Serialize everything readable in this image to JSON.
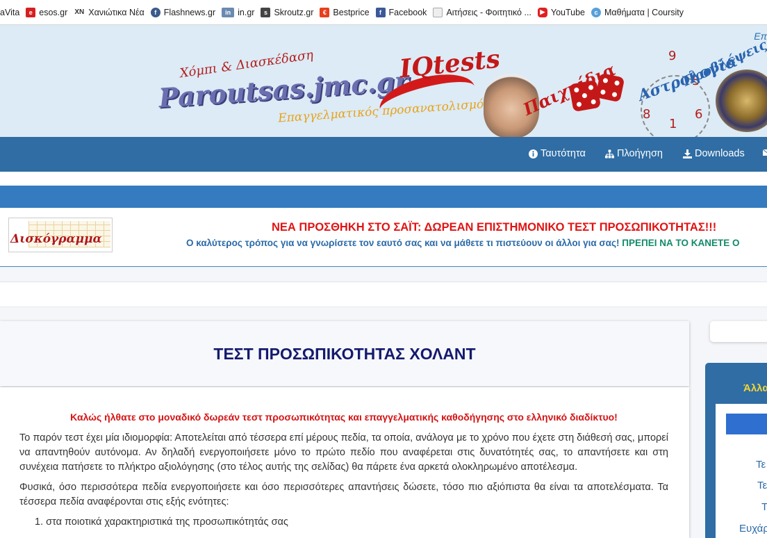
{
  "bookmarks": [
    {
      "label": "aVita",
      "icon": "none"
    },
    {
      "label": "esos.gr",
      "icon": "esos-icon"
    },
    {
      "label": "Χανιώτικα Νέα",
      "icon": "xn-icon"
    },
    {
      "label": "Flashnews.gr",
      "icon": "flashnews-icon"
    },
    {
      "label": "in.gr",
      "icon": "in-icon"
    },
    {
      "label": "Skroutz.gr",
      "icon": "skroutz-icon"
    },
    {
      "label": "Bestprice",
      "icon": "bestprice-icon"
    },
    {
      "label": "Facebook",
      "icon": "facebook-icon"
    },
    {
      "label": "Αιτήσεις - Φοιτητικό ...",
      "icon": "page-icon"
    },
    {
      "label": "YouTube",
      "icon": "youtube-icon"
    },
    {
      "label": "Μαθήματα | Coursity",
      "icon": "coursity-icon"
    }
  ],
  "banner": {
    "corner_text": "Επ",
    "logo_small": "Χόμπι & Διασκέδαση",
    "logo_big": "Paroutsas.jmc.gr",
    "iq_text": "IQtests",
    "slogan": "Επαγγελματικός προσανατολισμός",
    "games": "Παιχνίδια",
    "astrology": "Αστρολογία",
    "predictions": "Προβλέψεις",
    "clock_numbers": [
      "9",
      "5",
      "6",
      "8",
      "1"
    ]
  },
  "nav": {
    "items": [
      {
        "label": "Ταυτότητα",
        "icon": "info-icon"
      },
      {
        "label": "Πλοήγηση",
        "icon": "sitemap-icon"
      },
      {
        "label": "Downloads",
        "icon": "download-icon"
      }
    ]
  },
  "announcement": {
    "logo_text": "Δισκόγραμμα",
    "title": "ΝΕΑ ΠΡΟΣΘΗΚΗ ΣΤΟ ΣΑΪΤ: ΔΩΡΕΑΝ ΕΠΙΣΤΗΜΟΝΙΚΟ ΤΕΣΤ ΠΡΟΣΩΠΙΚΟΤΗΤΑΣ!!!",
    "subtitle_blue": "Ο καλύτερος τρόπος για να γνωρίσετε τον εαυτό σας και να μάθετε τι πιστεύουν οι άλλοι για σας!",
    "subtitle_green": "ΠΡΕΠΕΙ ΝΑ ΤΟ ΚΑΝΕΤΕ Ο"
  },
  "main": {
    "title": "ΤΕΣΤ ΠΡΟΣΩΠΙΚΟΤΗΤΑΣ ΧΟΛΑΝΤ",
    "welcome": "Καλώς ήλθατε στο μοναδικό δωρεάν τεστ προσωπικότητας και επαγγελματικής καθοδήγησης στο ελληνικό διαδίκτυο!",
    "para1": "Το παρόν τεστ έχει μία ιδιομορφία: Αποτελείται από τέσσερα επί μέρους πεδία, τα οποία, ανάλογα με το χρόνο που έχετε στη διάθεσή σας, μπορεί να απαντηθούν αυτόνομα. Αν δηλαδή ενεργοποιήσετε μόνο το πρώτο πεδίο που αναφέρεται στις δυνατότητές σας, το απαντήσετε και στη συνέχεια πατήσετε το πλήκτρο αξιολόγησης (στο τέλος αυτής της σελίδας) θα πάρετε ένα αρκετά ολοκληρωμένο αποτέλεσμα.",
    "para2": "Φυσικά, όσο περισσότερα πεδία ενεργοποιήσετε και όσο περισσότερες απαντήσεις δώσετε, τόσο πιο αξιόπιστα θα είναι τα αποτελέσματα. Τα τέσσερα πεδία αναφέρονται στις εξής ενότητες:",
    "list_item_1": "1. στα ποιοτικά χαρακτηριστικά της προσωπικότητάς σας"
  },
  "sidebar": {
    "heading": "Άλλα",
    "links": [
      "Τε",
      "Τε",
      "Τ",
      "Ευχάρ"
    ]
  }
}
